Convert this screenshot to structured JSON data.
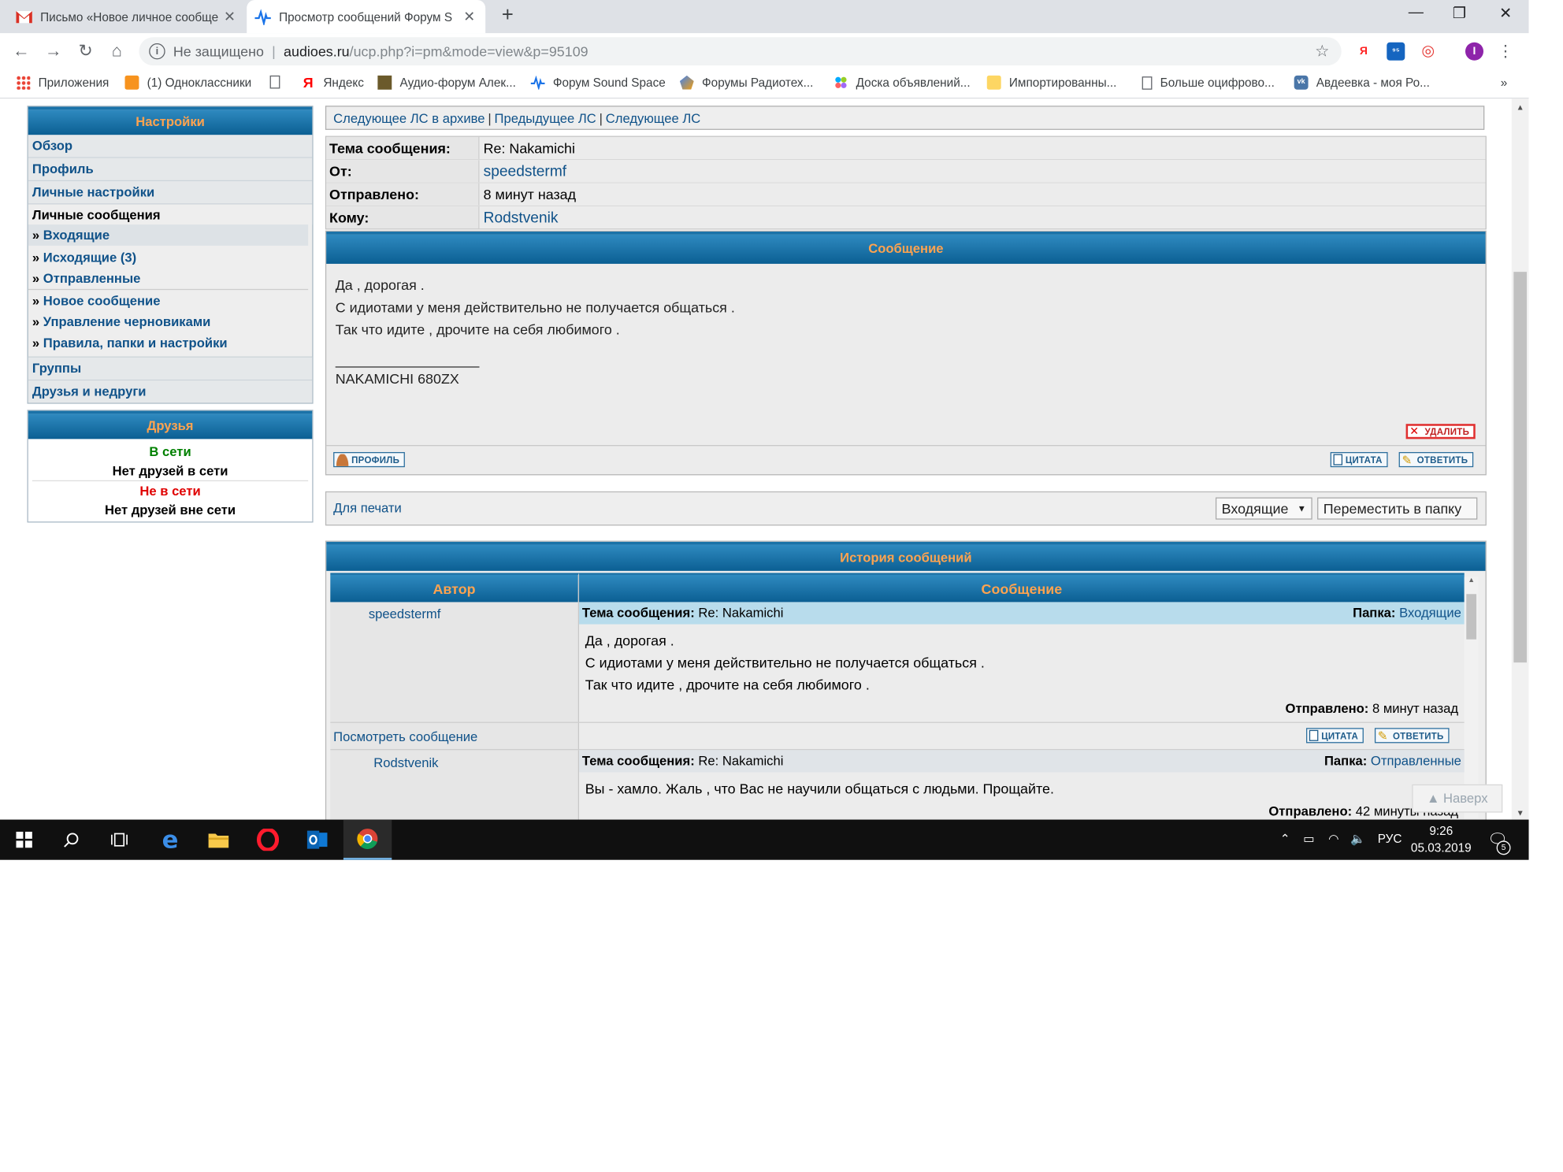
{
  "browser": {
    "tabs": [
      {
        "title": "Письмо «Новое личное сообще",
        "active": false,
        "icon": "gmail-icon"
      },
      {
        "title": "Просмотр сообщений Форум S",
        "active": true,
        "icon": "forum-wave-icon"
      }
    ],
    "address": {
      "security": "Не защищено",
      "separator": "|",
      "host": "audioes.ru",
      "path": "/ucp.php?i=pm&mode=view&p=95109"
    },
    "extensions": [
      {
        "label": "Я",
        "color": "#ff3333"
      },
      {
        "label": "⁹⁵",
        "color": "#1565c0"
      },
      {
        "label": "◎",
        "color": "#e53935"
      },
      {
        "label": "I",
        "color": "#8e24aa"
      }
    ],
    "bookmarks": [
      "Приложения",
      "(1) Одноклассники",
      "",
      "Яндекс",
      "Аудио-форум Алек...",
      "Форум Sound Space",
      "Форумы Радиотех...",
      "Доска объявлений...",
      "Импортированны...",
      "Больше оцифрово...",
      "Авдеевка - моя Ро..."
    ],
    "bookmarks_more": "»"
  },
  "sidebar": {
    "header": "Настройки",
    "items": [
      "Обзор",
      "Профиль",
      "Личные настройки"
    ],
    "pm_label": "Личные сообщения",
    "pm_items": [
      "Входящие",
      "Исходящие (3)",
      "Отправленные",
      "Новое сообщение",
      "Управление черновиками",
      "Правила, папки и настройки"
    ],
    "raquo": "»",
    "items_after": [
      "Группы",
      "Друзья и недруги"
    ]
  },
  "friends": {
    "header": "Друзья",
    "online_label": "В сети",
    "online_none": "Нет друзей в сети",
    "offline_label": "Не в сети",
    "offline_none": "Нет друзей вне сети"
  },
  "nav": {
    "next_archive": "Следующее ЛС в архиве",
    "sep": "|",
    "prev": "Предыдущее ЛС",
    "next": "Следующее ЛС"
  },
  "headers": {
    "subject_label": "Тема сообщения:",
    "subject": "Re: Nakamichi",
    "from_label": "От:",
    "from": "speedstermf",
    "sent_label": "Отправлено:",
    "sent": "8 минут назад",
    "to_label": "Кому:",
    "to": "Rodstvenik"
  },
  "message": {
    "header": "Сообщение",
    "lines": [
      "Да , дорогая .",
      "С идиотами у меня действительно не получается общаться .",
      "Так что идите , дрочите на себя любимого ."
    ],
    "signature_rule": "__________________",
    "signature": "NAKAMICHI 680ZX",
    "delete_btn": "УДАЛИТЬ",
    "profile_btn": "ПРОФИЛЬ",
    "quote_btn": "ЦИТАТА",
    "reply_btn": "ОТВЕТИТЬ"
  },
  "actions": {
    "print": "Для печати",
    "folder_select": "Входящие",
    "move_btn": "Переместить в папку"
  },
  "history": {
    "header": "История сообщений",
    "col_author": "Автор",
    "col_message": "Сообщение",
    "subject_label": "Тема сообщения:",
    "folder_label": "Папка:",
    "sent_label": "Отправлено:",
    "view_link": "Посмотреть сообщение",
    "quote_btn": "ЦИТАТА",
    "reply_btn": "ОТВЕТИТЬ",
    "entries": [
      {
        "author": "speedstermf",
        "subject": "Re: Nakamichi",
        "folder": "Входящие",
        "lines": [
          "Да , дорогая .",
          "С идиотами у меня действительно не получается общаться .",
          "Так что идите , дрочите на себя любимого ."
        ],
        "sent": "8 минут назад"
      },
      {
        "author": "Rodstvenik",
        "subject": "Re: Nakamichi",
        "folder": "Отправленные",
        "lines": [
          "Вы - хамло. Жаль , что Вас не научили общаться с людьми. Прощайте."
        ],
        "sent": "42 минуты назад"
      }
    ]
  },
  "back_to_top": "▲ Наверх",
  "taskbar": {
    "lang": "РУС",
    "time": "9:26",
    "date": "05.03.2019",
    "notifications": "5"
  }
}
